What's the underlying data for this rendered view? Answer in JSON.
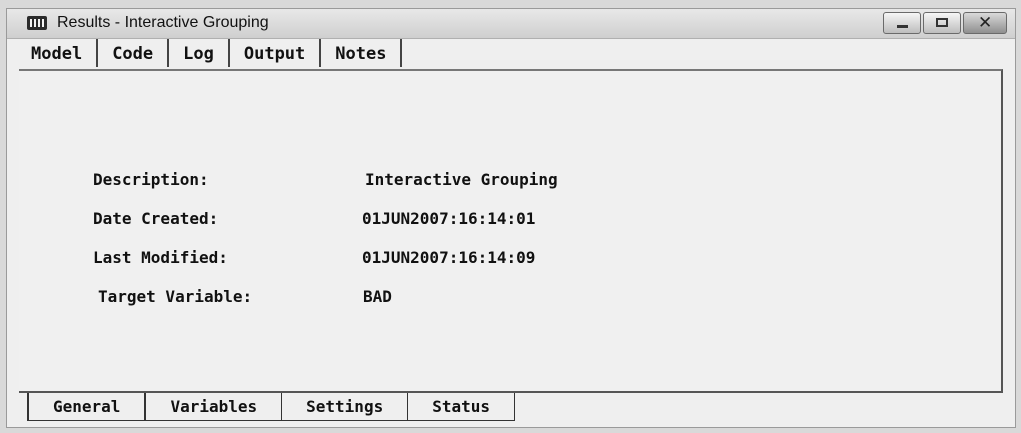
{
  "window": {
    "title": "Results - Interactive Grouping",
    "icon": "results-window-icon"
  },
  "top_tabs": [
    {
      "label": "Model",
      "active": true
    },
    {
      "label": "Code"
    },
    {
      "label": "Log"
    },
    {
      "label": "Output"
    },
    {
      "label": "Notes"
    }
  ],
  "fields": [
    {
      "label": "Description:",
      "value": "Interactive Grouping"
    },
    {
      "label": "Date Created:",
      "value": "01JUN2007:16:14:01"
    },
    {
      "label": "Last Modified:",
      "value": "01JUN2007:16:14:09"
    },
    {
      "label": "Target Variable:",
      "value": "BAD"
    }
  ],
  "bottom_tabs": [
    {
      "label": "General",
      "active": true
    },
    {
      "label": "Variables"
    },
    {
      "label": "Settings"
    },
    {
      "label": "Status"
    }
  ]
}
